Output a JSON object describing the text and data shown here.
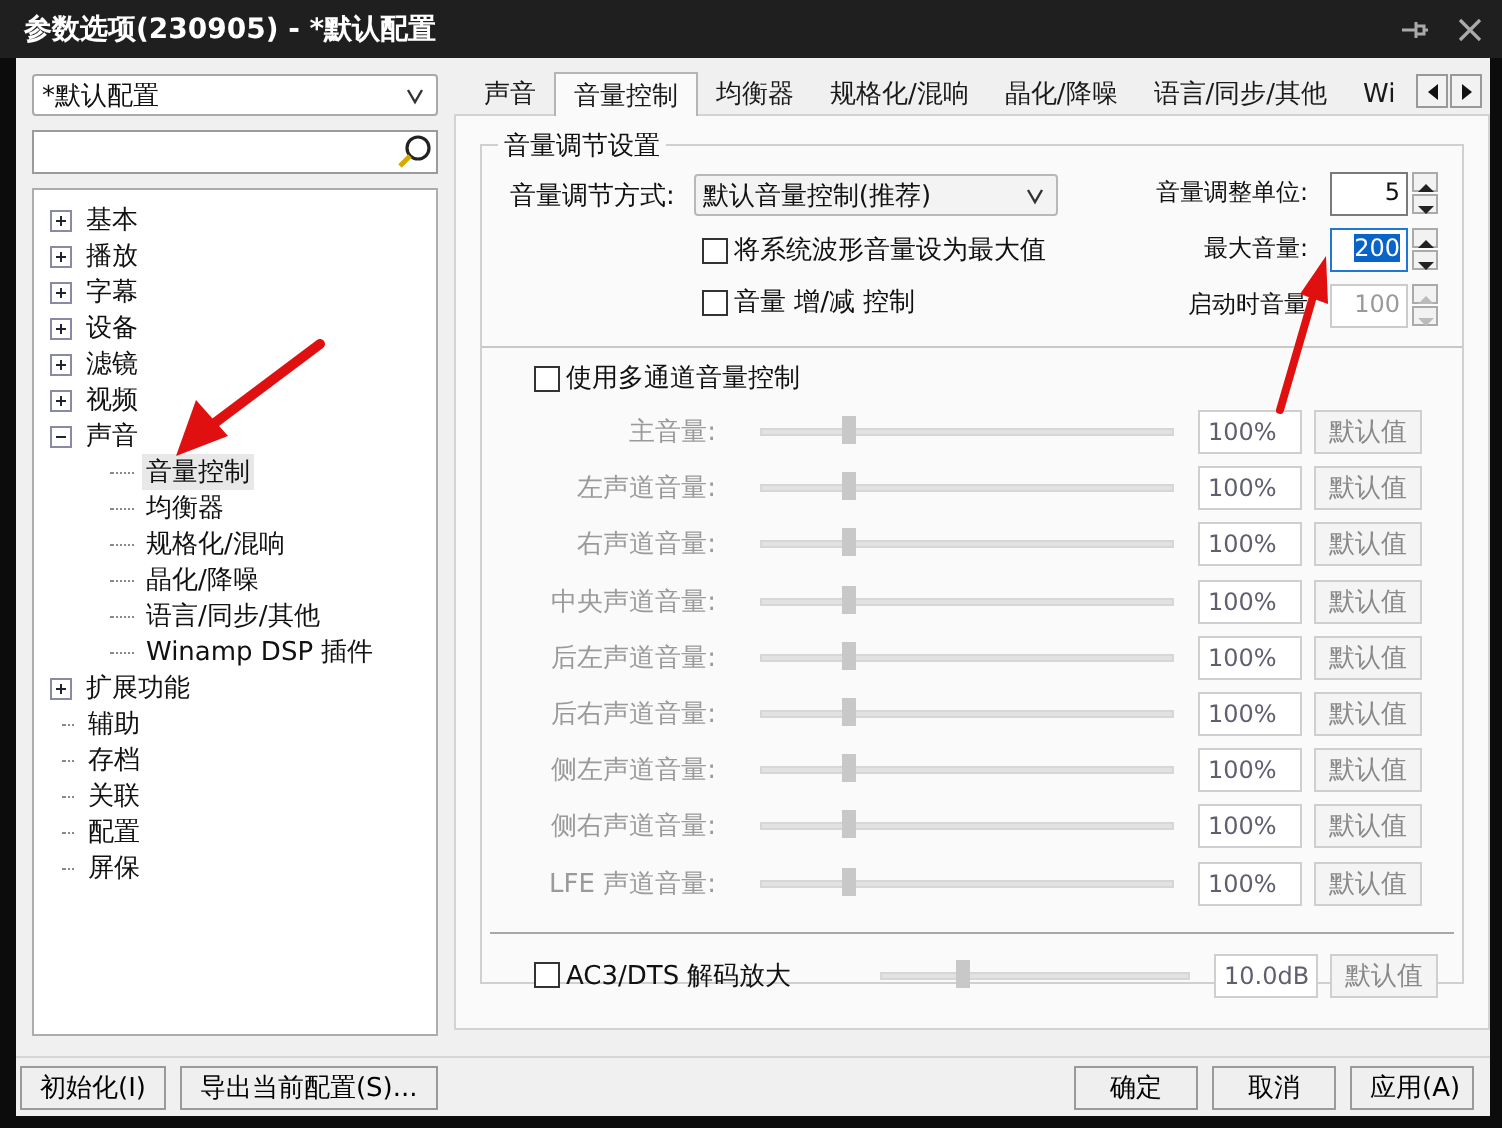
{
  "window": {
    "title": "参数选项(230905) - *默认配置"
  },
  "profile_select": {
    "value": "*默认配置"
  },
  "tree": [
    {
      "label": "基本",
      "expanded": false,
      "selected": false
    },
    {
      "label": "播放",
      "expanded": false,
      "selected": false
    },
    {
      "label": "字幕",
      "expanded": false,
      "selected": false
    },
    {
      "label": "设备",
      "expanded": false,
      "selected": false
    },
    {
      "label": "滤镜",
      "expanded": false,
      "selected": false
    },
    {
      "label": "视频",
      "expanded": false,
      "selected": false
    },
    {
      "label": "声音",
      "expanded": true,
      "selected": false,
      "children": [
        {
          "label": "音量控制",
          "selected": true
        },
        {
          "label": "均衡器",
          "selected": false
        },
        {
          "label": "规格化/混响",
          "selected": false
        },
        {
          "label": "晶化/降噪",
          "selected": false
        },
        {
          "label": "语言/同步/其他",
          "selected": false
        },
        {
          "label": "Winamp DSP 插件",
          "selected": false
        }
      ]
    },
    {
      "label": "扩展功能",
      "expanded": false,
      "selected": false
    },
    {
      "label": "辅助",
      "selected": false
    },
    {
      "label": "存档",
      "selected": false
    },
    {
      "label": "关联",
      "selected": false
    },
    {
      "label": "配置",
      "selected": false
    },
    {
      "label": "屏保",
      "selected": false
    }
  ],
  "tabs": [
    {
      "label": "声音",
      "selected": false
    },
    {
      "label": "音量控制",
      "selected": true
    },
    {
      "label": "均衡器",
      "selected": false
    },
    {
      "label": "规格化/混响",
      "selected": false
    },
    {
      "label": "晶化/降噪",
      "selected": false
    },
    {
      "label": "语言/同步/其他",
      "selected": false
    },
    {
      "label": "Wi",
      "selected": false
    }
  ],
  "group": {
    "title": "音量调节设置",
    "mode_label": "音量调节方式:",
    "mode_value": "默认音量控制(推荐)",
    "checkboxes": [
      {
        "label": "将系统波形音量设为最大值",
        "checked": false
      },
      {
        "label": "音量 增/减 控制",
        "checked": false
      }
    ],
    "spins": [
      {
        "label": "音量调整单位:",
        "value": "5",
        "highlighted": false,
        "disabled": false
      },
      {
        "label": "最大音量:",
        "value": "200",
        "highlighted": true,
        "disabled": false
      },
      {
        "label": "启动时音量",
        "value": "100",
        "highlighted": false,
        "disabled": true
      }
    ],
    "multichannel": {
      "label": "使用多通道音量控制",
      "checked": false
    },
    "channels": [
      {
        "label": "主音量:",
        "level": 0.21,
        "value": "100%",
        "button": "默认值",
        "disabled": true
      },
      {
        "label": "左声道音量:",
        "level": 0.21,
        "value": "100%",
        "button": "默认值",
        "disabled": true
      },
      {
        "label": "右声道音量:",
        "level": 0.21,
        "value": "100%",
        "button": "默认值",
        "disabled": true
      },
      {
        "label": "中央声道音量:",
        "level": 0.21,
        "value": "100%",
        "button": "默认值",
        "disabled": true
      },
      {
        "label": "后左声道音量:",
        "level": 0.21,
        "value": "100%",
        "button": "默认值",
        "disabled": true
      },
      {
        "label": "后右声道音量:",
        "level": 0.21,
        "value": "100%",
        "button": "默认值",
        "disabled": true
      },
      {
        "label": "侧左声道音量:",
        "level": 0.21,
        "value": "100%",
        "button": "默认值",
        "disabled": true
      },
      {
        "label": "侧右声道音量:",
        "level": 0.21,
        "value": "100%",
        "button": "默认值",
        "disabled": true
      },
      {
        "label": "LFE 声道音量:",
        "level": 0.21,
        "value": "100%",
        "button": "默认值",
        "disabled": true
      }
    ],
    "amplify": {
      "label": "AC3/DTS 解码放大",
      "checked": false,
      "level": 0.26,
      "value": "10.0dB",
      "button": "默认值",
      "disabled": true
    }
  },
  "left_buttons": [
    "初始化(I)",
    "导出当前配置(S)..."
  ],
  "right_buttons": [
    "确定",
    "取消",
    "应用(A)"
  ]
}
